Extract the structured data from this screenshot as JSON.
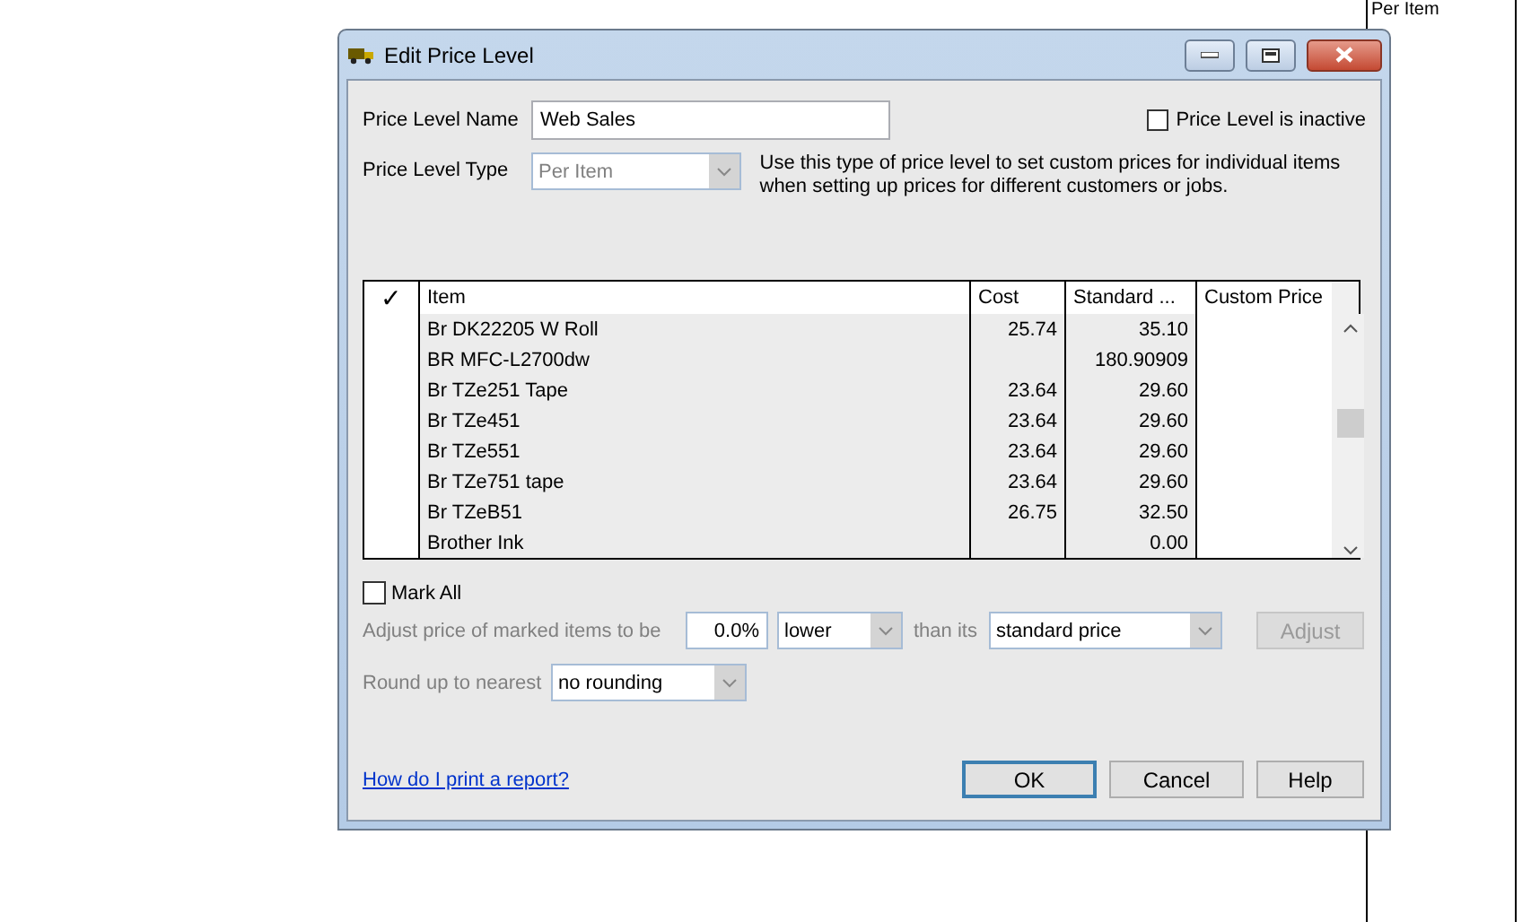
{
  "background": {
    "column_text": "Per Item"
  },
  "window": {
    "title": "Edit Price Level"
  },
  "name_field": {
    "label": "Price Level Name",
    "value": "Web Sales"
  },
  "inactive_checkbox": {
    "label": "Price Level is inactive",
    "checked": false
  },
  "type_field": {
    "label": "Price Level Type",
    "value": "Per Item",
    "disabled": true
  },
  "type_description": "Use this type of price level to set custom prices for individual items when setting up prices for different customers or jobs.",
  "table": {
    "columns": [
      "✓",
      "Item",
      "Cost",
      "Standard ...",
      "Custom Price"
    ],
    "rows": [
      {
        "item": "Br DK22205 W Roll",
        "cost": "25.74",
        "standard": "35.10",
        "custom": ""
      },
      {
        "item": "BR MFC-L2700dw",
        "cost": "",
        "standard": "180.90909",
        "custom": ""
      },
      {
        "item": "Br TZe251 Tape",
        "cost": "23.64",
        "standard": "29.60",
        "custom": ""
      },
      {
        "item": "Br TZe451",
        "cost": "23.64",
        "standard": "29.60",
        "custom": ""
      },
      {
        "item": "Br TZe551",
        "cost": "23.64",
        "standard": "29.60",
        "custom": ""
      },
      {
        "item": "Br TZe751 tape",
        "cost": "23.64",
        "standard": "29.60",
        "custom": ""
      },
      {
        "item": "Br TZeB51",
        "cost": "26.75",
        "standard": "32.50",
        "custom": ""
      },
      {
        "item": "Brother Ink",
        "cost": "",
        "standard": "0.00",
        "custom": ""
      }
    ]
  },
  "mark_all": {
    "label": "Mark All",
    "checked": false
  },
  "adjust": {
    "label": "Adjust price of marked items to be",
    "percent": "0.0%",
    "direction": "lower",
    "than_label": "than its",
    "basis": "standard price",
    "button": "Adjust",
    "disabled": true
  },
  "rounding": {
    "label": "Round up to nearest",
    "value": "no rounding",
    "disabled": true
  },
  "help_link": "How do I print a report?",
  "buttons": [
    {
      "label": "OK",
      "default": true
    },
    {
      "label": "Cancel",
      "default": false
    },
    {
      "label": "Help",
      "default": false
    }
  ]
}
